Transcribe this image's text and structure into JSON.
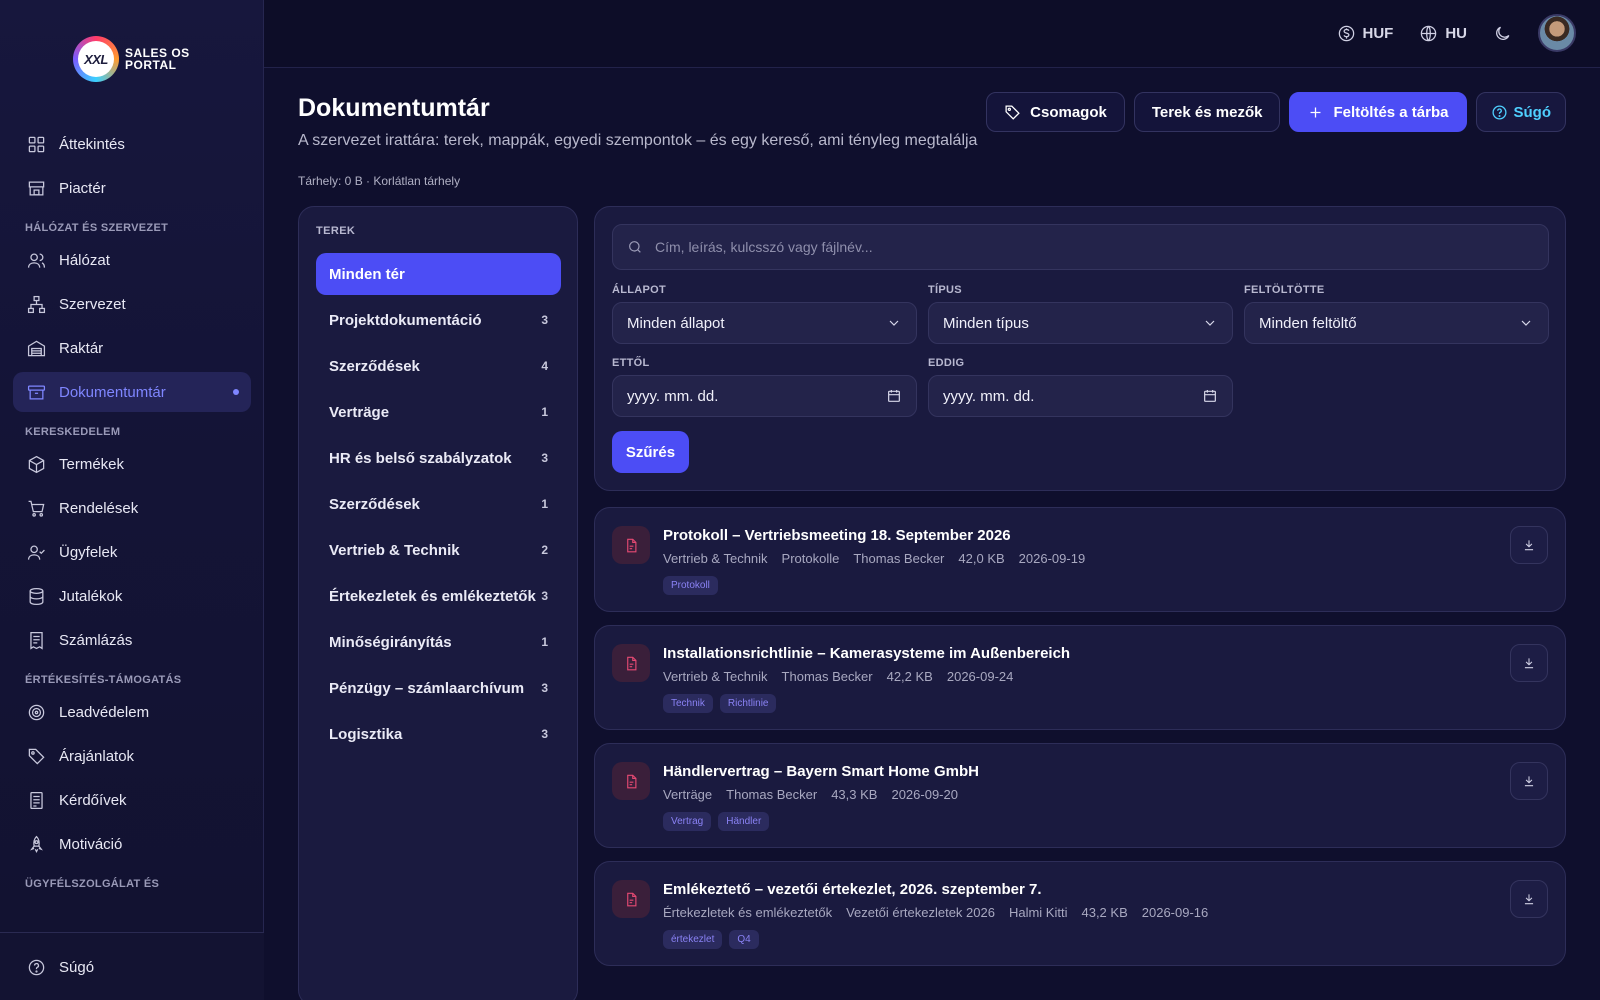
{
  "app": {
    "logo_mark": "XXL",
    "logo_line1": "SALES OS",
    "logo_line2": "PORTAL"
  },
  "topbar": {
    "currency": "HUF",
    "language": "HU",
    "icons": [
      "dollar-icon",
      "globe-icon",
      "moon-icon"
    ]
  },
  "sidebar": {
    "items": [
      {
        "label": "Áttekintés",
        "icon": "grid-icon"
      },
      {
        "label": "Piactér",
        "icon": "store-icon"
      }
    ],
    "section_network": "HÁLÓZAT ÉS SZERVEZET",
    "network_items": [
      {
        "label": "Hálózat",
        "icon": "users-icon"
      },
      {
        "label": "Szervezet",
        "icon": "org-icon"
      },
      {
        "label": "Raktár",
        "icon": "warehouse-icon"
      },
      {
        "label": "Dokumentumtár",
        "icon": "archive-icon"
      }
    ],
    "section_commerce": "KERESKEDELEM",
    "commerce_items": [
      {
        "label": "Termékek",
        "icon": "box-icon"
      },
      {
        "label": "Rendelések",
        "icon": "cart-icon"
      },
      {
        "label": "Ügyfelek",
        "icon": "user-check-icon"
      },
      {
        "label": "Jutalékok",
        "icon": "database-icon"
      },
      {
        "label": "Számlázás",
        "icon": "receipt-icon"
      }
    ],
    "section_sales": "ÉRTÉKESÍTÉS-TÁMOGATÁS",
    "sales_items": [
      {
        "label": "Leadvédelem",
        "icon": "target-icon"
      },
      {
        "label": "Árajánlatok",
        "icon": "tag-icon"
      },
      {
        "label": "Kérdőívek",
        "icon": "form-icon"
      },
      {
        "label": "Motiváció",
        "icon": "rocket-icon"
      }
    ],
    "section_support": "ÜGYFÉLSZOLGÁLAT ÉS",
    "bottom_item": {
      "label": "Súgó",
      "icon": "help-icon"
    }
  },
  "page": {
    "title": "Dokumentumtár",
    "subtitle": "A szervezet irattára: terek, mappák, egyedi szempontok – és egy kereső, ami tényleg megtalálja",
    "storage": "Tárhely: 0 B · Korlátlan tárhely",
    "btn_packages": "Csomagok",
    "btn_spaces": "Terek és mezők",
    "btn_upload": "Feltöltés a tárba",
    "btn_help": "Súgó"
  },
  "spaces": {
    "heading": "TEREK",
    "items": [
      {
        "label": "Minden tér",
        "count": ""
      },
      {
        "label": "Projektdokumentáció",
        "count": "3"
      },
      {
        "label": "Szerződések",
        "count": "4"
      },
      {
        "label": "Verträge",
        "count": "1"
      },
      {
        "label": "HR és belső szabályzatok",
        "count": "3"
      },
      {
        "label": "Szerződések",
        "count": "1"
      },
      {
        "label": "Vertrieb & Technik",
        "count": "2"
      },
      {
        "label": "Értekezletek és emlékeztetők",
        "count": "3"
      },
      {
        "label": "Minőségirányítás",
        "count": "1"
      },
      {
        "label": "Pénzügy – számlaarchívum",
        "count": "3"
      },
      {
        "label": "Logisztika",
        "count": "3"
      }
    ]
  },
  "filters": {
    "search_placeholder": "Cím, leírás, kulcsszó vagy fájlnév...",
    "status_label": "ÁLLAPOT",
    "status_value": "Minden állapot",
    "type_label": "TÍPUS",
    "type_value": "Minden típus",
    "uploader_label": "FELTÖLTÖTTE",
    "uploader_value": "Minden feltöltő",
    "from_label": "ETTŐL",
    "from_value": "yyyy. mm. dd.",
    "to_label": "EDDIG",
    "to_value": "yyyy. mm. dd.",
    "submit": "Szűrés"
  },
  "documents": [
    {
      "title": "Protokoll – Vertriebsmeeting 18. September 2026",
      "meta": [
        "Vertrieb & Technik",
        "Protokolle",
        "Thomas Becker",
        "42,0 KB",
        "2026-09-19"
      ],
      "tags": [
        "Protokoll"
      ]
    },
    {
      "title": "Installationsrichtlinie – Kamerasysteme im Außenbereich",
      "meta": [
        "Vertrieb & Technik",
        "Thomas Becker",
        "42,2 KB",
        "2026-09-24"
      ],
      "tags": [
        "Technik",
        "Richtlinie"
      ]
    },
    {
      "title": "Händlervertrag – Bayern Smart Home GmbH",
      "meta": [
        "Verträge",
        "Thomas Becker",
        "43,3 KB",
        "2026-09-20"
      ],
      "tags": [
        "Vertrag",
        "Händler"
      ]
    },
    {
      "title": "Emlékeztető – vezetői értekezlet, 2026. szeptember 7.",
      "meta": [
        "Értekezletek és emlékeztetők",
        "Vezetői értekezletek 2026",
        "Halmi Kitti",
        "43,2 KB",
        "2026-09-16"
      ],
      "tags": [
        "értekezlet",
        "Q4"
      ]
    }
  ]
}
